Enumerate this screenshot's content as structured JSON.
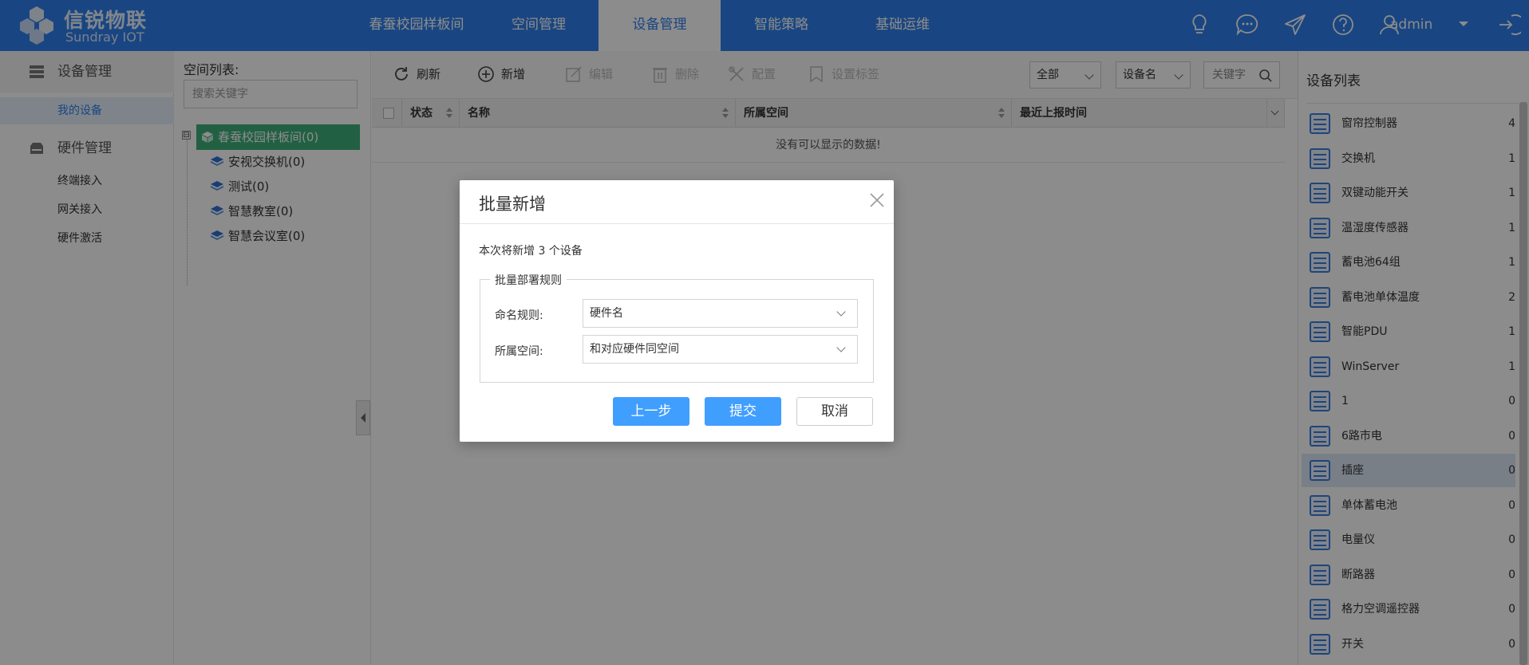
{
  "brand": {
    "name_cn": "信锐物联",
    "name_en": "Sundray IOT"
  },
  "topnav": [
    {
      "label": "春蚕校园样板间",
      "active": false
    },
    {
      "label": "空间管理",
      "active": false
    },
    {
      "label": "设备管理",
      "active": true
    },
    {
      "label": "智能策略",
      "active": false
    },
    {
      "label": "基础运维",
      "active": false
    }
  ],
  "user": {
    "name": "admin"
  },
  "icons": [
    "lightbulb-icon",
    "chat-icon",
    "send-icon",
    "help-icon",
    "user-icon",
    "caret-down-icon",
    "logout-icon"
  ],
  "sidebar": {
    "group1": {
      "label": "设备管理",
      "items": [
        {
          "label": "我的设备",
          "active": true
        }
      ]
    },
    "group2": {
      "label": "硬件管理",
      "items": [
        {
          "label": "终端接入"
        },
        {
          "label": "网关接入"
        },
        {
          "label": "硬件激活"
        }
      ]
    }
  },
  "space_panel": {
    "title": "空间列表:",
    "search_placeholder": "搜索关键字",
    "root": {
      "label": "春蚕校园样板间(0)",
      "toggle": "⊟"
    },
    "children": [
      {
        "label": "安视交换机(0)"
      },
      {
        "label": "测试(0)"
      },
      {
        "label": "智慧教室(0)"
      },
      {
        "label": "智慧会议室(0)"
      }
    ]
  },
  "toolbar": {
    "refresh": "刷新",
    "add": "新增",
    "edit": "编辑",
    "delete": "删除",
    "config": "配置",
    "set_tag": "设置标签",
    "filter_scope": "全部",
    "filter_field": "设备名",
    "search_placeholder": "关键字"
  },
  "table": {
    "columns": [
      "状态",
      "名称",
      "所属空间",
      "最近上报时间"
    ],
    "empty_text": "没有可以显示的数据!"
  },
  "device_list": {
    "title": "设备列表",
    "items": [
      {
        "name": "窗帘控制器",
        "count": "4"
      },
      {
        "name": "交换机",
        "count": "1"
      },
      {
        "name": "双键动能开关",
        "count": "1"
      },
      {
        "name": "温湿度传感器",
        "count": "1"
      },
      {
        "name": "蓄电池64组",
        "count": "1"
      },
      {
        "name": "蓄电池单体温度",
        "count": "2"
      },
      {
        "name": "智能PDU",
        "count": "1"
      },
      {
        "name": "WinServer",
        "count": "1"
      },
      {
        "name": "1",
        "count": "0"
      },
      {
        "name": "6路市电",
        "count": "0"
      },
      {
        "name": "插座",
        "count": "0",
        "active": true
      },
      {
        "name": "单体蓄电池",
        "count": "0"
      },
      {
        "name": "电量仪",
        "count": "0"
      },
      {
        "name": "断路器",
        "count": "0"
      },
      {
        "name": "格力空调遥控器",
        "count": "0"
      },
      {
        "name": "开关",
        "count": "0"
      }
    ]
  },
  "modal": {
    "title": "批量新增",
    "info": "本次将新增 3 个设备",
    "fieldset_legend": "批量部署规则",
    "naming_label": "命名规则:",
    "naming_value": "硬件名",
    "space_label": "所属空间:",
    "space_value": "和对应硬件同空间",
    "prev_button": "上一步",
    "submit_button": "提交",
    "cancel_button": "取消"
  }
}
